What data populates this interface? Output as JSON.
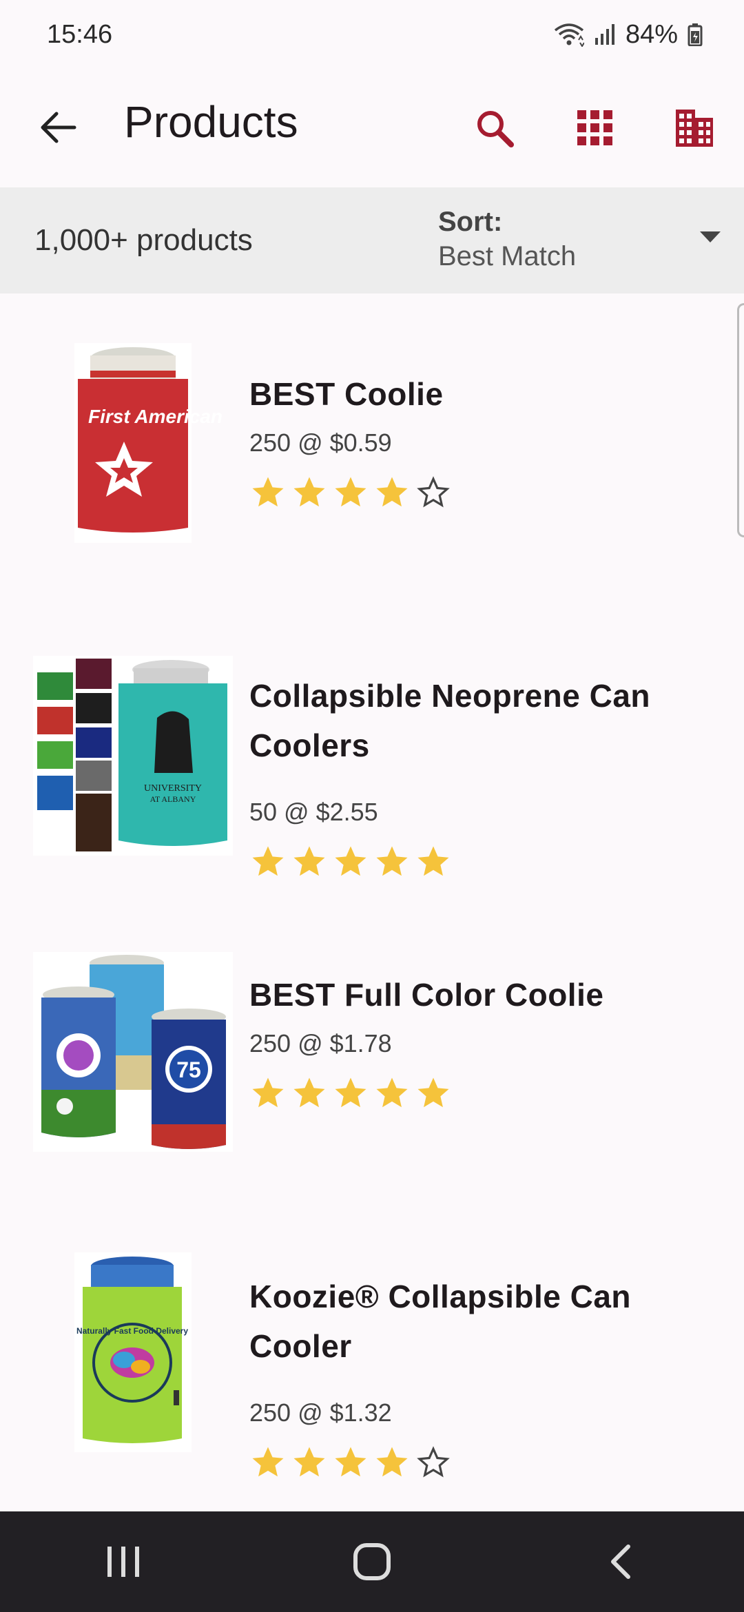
{
  "status_bar": {
    "time": "15:46",
    "battery": "84%",
    "icons": [
      "wifi-icon",
      "signal-icon",
      "battery-icon"
    ]
  },
  "app_bar": {
    "title": "Products",
    "back_icon": "arrow-left-icon",
    "actions": [
      "search-icon",
      "grid-view-icon",
      "building-icon"
    ],
    "accent_color": "#a51c30"
  },
  "sort_bar": {
    "count": "1,000+ products",
    "sort_label": "Sort:",
    "sort_value": "Best Match"
  },
  "products": [
    {
      "name": "BEST Coolie",
      "price": "250 @ $0.59",
      "rating": 4,
      "image": "red-can-cooler-first-american",
      "thumb_text": "First American"
    },
    {
      "name": "Collapsible Neoprene Can Coolers",
      "price": "50 @ $2.55",
      "rating": 5,
      "image": "teal-can-cooler-university-albany",
      "thumb_text": "UNIVERSITY AT ALBANY"
    },
    {
      "name": "BEST Full Color Coolie",
      "price": "250 @ $1.78",
      "rating": 5,
      "image": "full-color-can-coolers",
      "thumb_text": "75"
    },
    {
      "name": "Koozie® Collapsible Can Cooler",
      "price": "250 @ $1.32",
      "rating": 4,
      "image": "lime-can-cooler-naturally-fast",
      "thumb_text": "Naturally Fast Food Delivery"
    }
  ],
  "colors": {
    "star_filled": "#f5c33b",
    "accent": "#a51c30",
    "nav_bg": "#222024"
  },
  "nav_bar": {
    "buttons": [
      "recent-apps-icon",
      "home-icon",
      "back-icon"
    ]
  }
}
